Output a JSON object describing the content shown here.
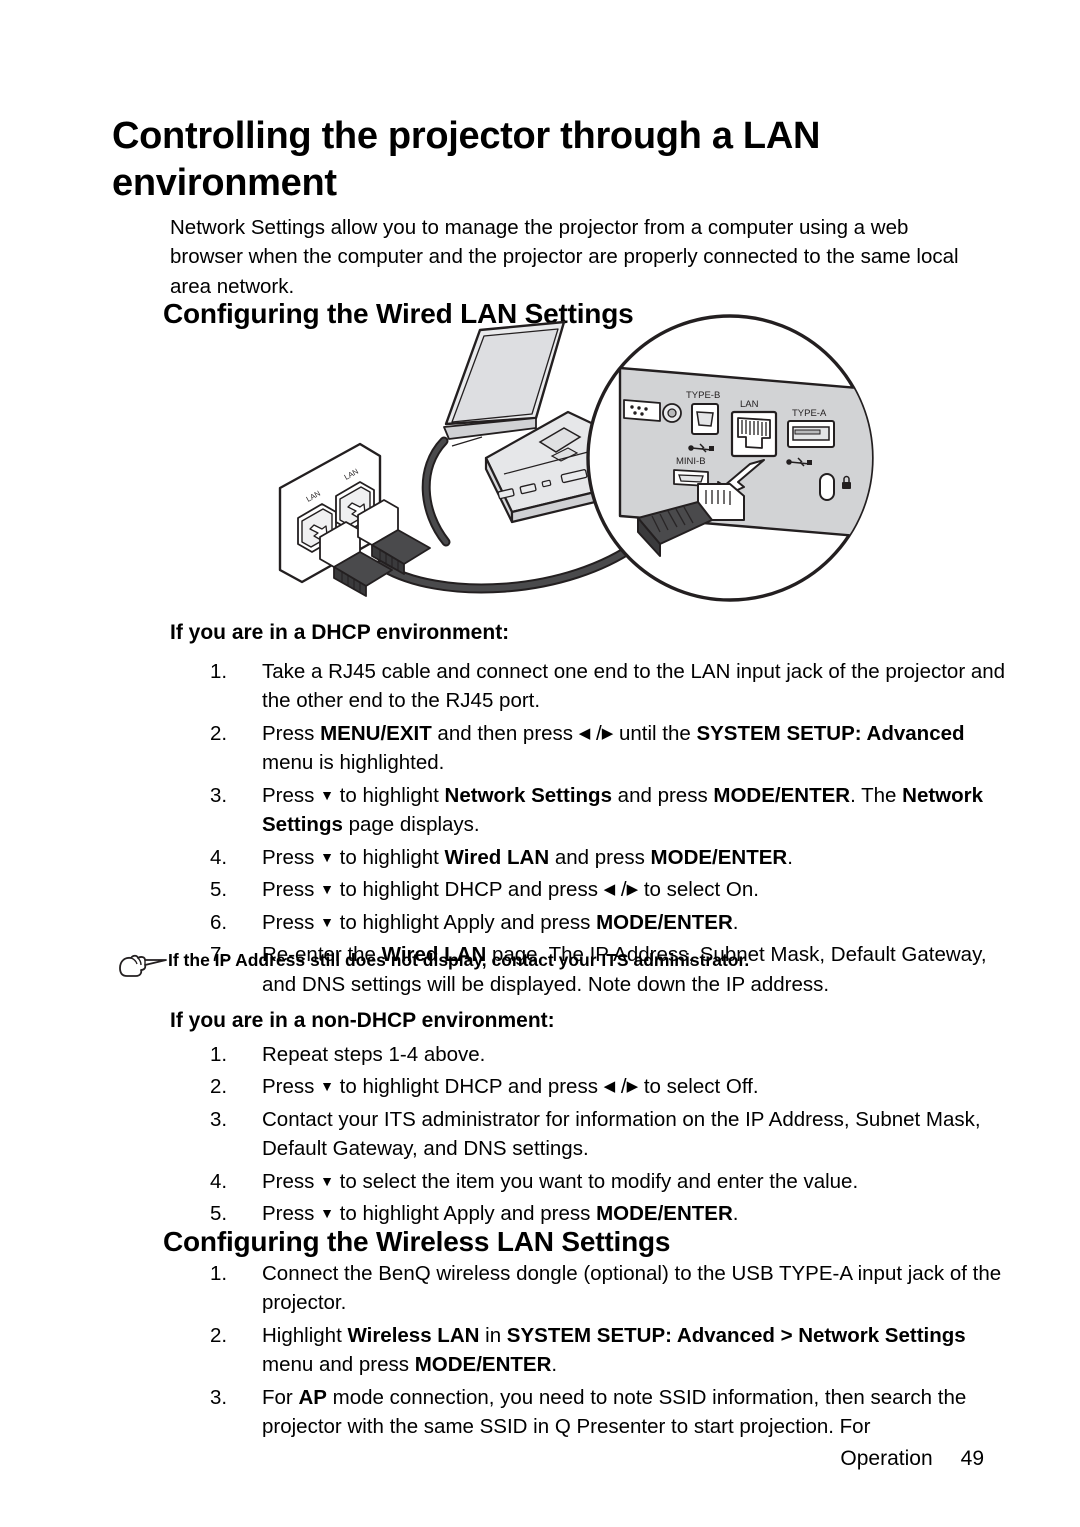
{
  "chapter": {
    "title": "Controlling the projector through a LAN environment",
    "intro": "Network Settings allow you to manage the projector from a computer using a web browser when the computer and the projector are properly connected to the same local area network."
  },
  "sections": {
    "wired": {
      "heading": "Configuring the Wired LAN Settings"
    },
    "wireless": {
      "heading": "Configuring the Wireless LAN Settings"
    }
  },
  "subheadings": {
    "dhcp": "If you are in a DHCP environment:",
    "non_dhcp": "If you are in a non-DHCP environment:"
  },
  "steps_dhcp": [
    {
      "num": "1.",
      "html": "Take a RJ45 cable and connect one end to the LAN input jack of the projector and the other end to the RJ45 port."
    },
    {
      "num": "2.",
      "html": "Press <b>MENU/EXIT</b> and then press <span class=\"arr\">&#9664;</span> /<span class=\"arr\">&#9654;</span> until the <b>SYSTEM SETUP: Advanced</b> menu is highlighted."
    },
    {
      "num": "3.",
      "html": "Press <span class=\"arr arr-dn\">&#9660;</span> to highlight <b>Network Settings</b> and press <b>MODE/ENTER</b>. The <b>Network Settings</b> page displays."
    },
    {
      "num": "4.",
      "html": "Press <span class=\"arr arr-dn\">&#9660;</span> to highlight <b>Wired LAN</b> and press <b>MODE/ENTER</b>."
    },
    {
      "num": "5.",
      "html": "Press <span class=\"arr arr-dn\">&#9660;</span> to highlight DHCP and press <span class=\"arr\">&#9664;</span> /<span class=\"arr\">&#9654;</span> to select On."
    },
    {
      "num": "6.",
      "html": "Press <span class=\"arr arr-dn\">&#9660;</span> to highlight Apply and press <b>MODE/ENTER</b>."
    },
    {
      "num": "7.",
      "html": "Re-enter the <b>Wired LAN</b> page. The IP Address, Subnet Mask, Default Gateway, and DNS settings will be displayed. Note down the IP address."
    }
  ],
  "note": {
    "icon": "pointing-hand-icon",
    "text": "If the IP Address still does not display, contact your ITS administrator."
  },
  "steps_non_dhcp": [
    {
      "num": "1.",
      "html": "Repeat steps 1-4 above."
    },
    {
      "num": "2.",
      "html": "Press <span class=\"arr arr-dn\">&#9660;</span> to highlight DHCP and press <span class=\"arr\">&#9664;</span> /<span class=\"arr\">&#9654;</span> to select Off."
    },
    {
      "num": "3.",
      "html": "Contact your ITS administrator for information on the IP Address, Subnet Mask, Default Gateway, and DNS settings."
    },
    {
      "num": "4.",
      "html": "Press <span class=\"arr arr-dn\">&#9660;</span> to select the item you want to modify and enter the value."
    },
    {
      "num": "5.",
      "html": "Press <span class=\"arr arr-dn\">&#9660;</span> to highlight Apply and press <b>MODE/ENTER</b>."
    }
  ],
  "steps_wireless": [
    {
      "num": "1.",
      "html": "Connect the BenQ wireless dongle (optional) to the USB TYPE-A input jack of the projector."
    },
    {
      "num": "2.",
      "html": "Highlight <b>Wireless LAN</b> in <b>SYSTEM SETUP: Advanced &gt; Network Settings</b> menu and press <b>MODE/ENTER</b>."
    },
    {
      "num": "3.",
      "html": "For <b>AP</b> mode connection, you need to note SSID information, then search the projector with the same SSID in Q Presenter to start projection. For"
    }
  ],
  "figure": {
    "alt": "Laptop connected by RJ45 cable to a wall LAN plate, with a magnified callout of the projector rear connector panel",
    "wall_plate_labels": [
      "LAN",
      "LAN"
    ],
    "panel_labels": {
      "type_b": "TYPE-B",
      "lan": "LAN",
      "type_a": "TYPE-A",
      "mini_b": "MINI-B"
    },
    "colors": {
      "panel_fill": "#d2d3d5",
      "device_fill": "#e2e3e5",
      "cable": "#3a3a3c",
      "outline": "#231f20"
    }
  },
  "footer": {
    "label": "Operation",
    "page": "49"
  }
}
